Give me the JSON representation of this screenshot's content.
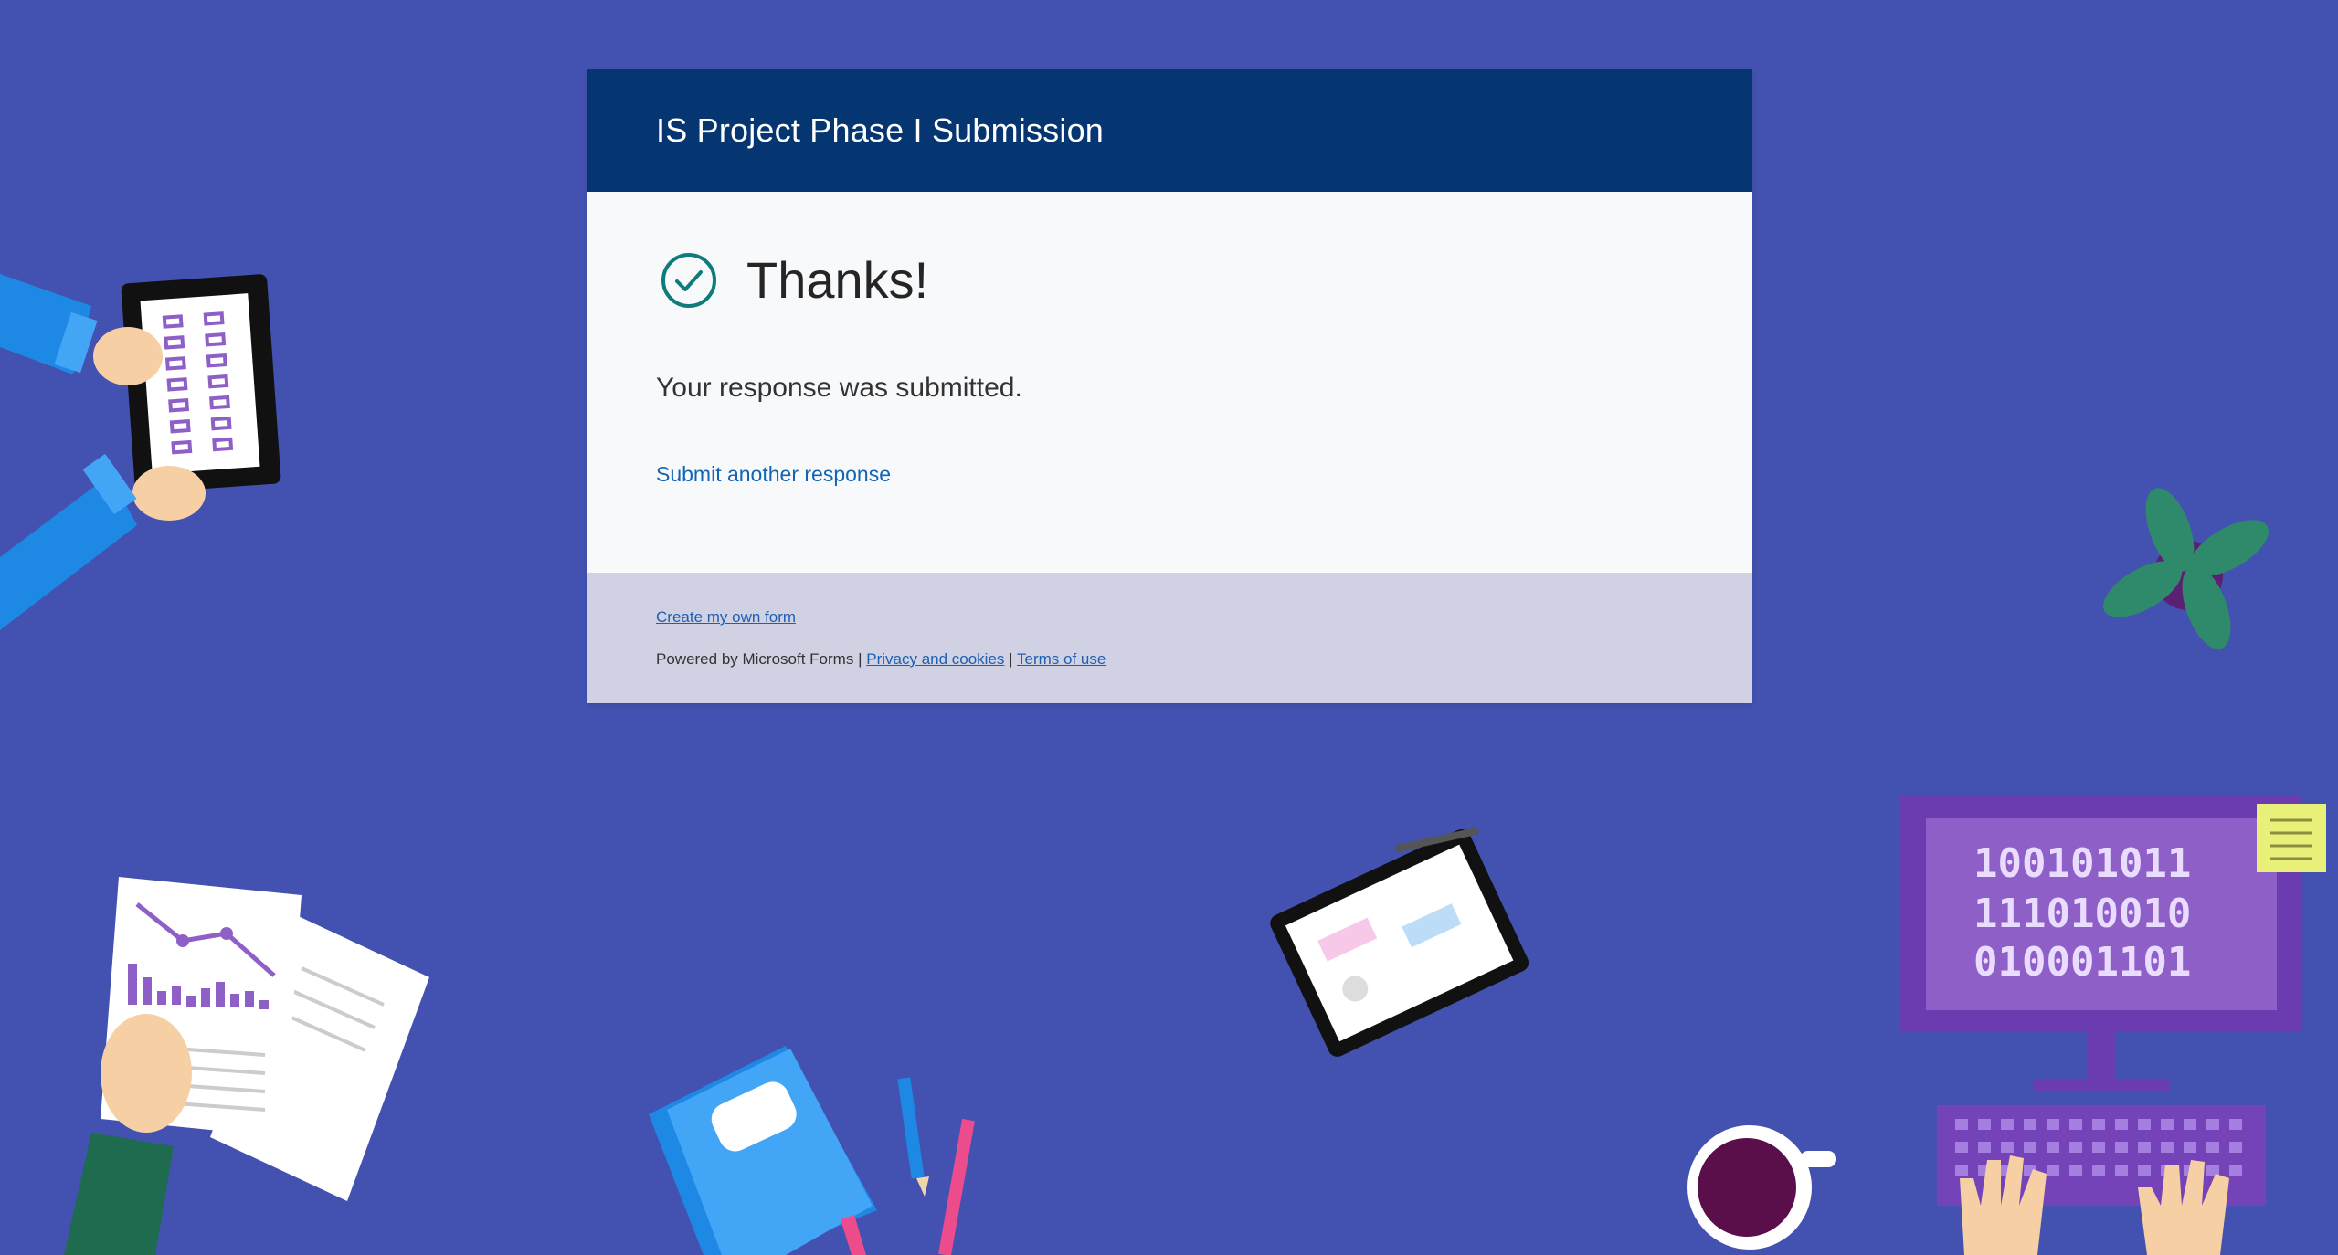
{
  "form": {
    "title": "IS Project Phase I Submission"
  },
  "confirmation": {
    "heading": "Thanks!",
    "message": "Your response was submitted.",
    "submit_another_label": "Submit another response"
  },
  "footer": {
    "create_form_label": "Create my own form",
    "powered_by": "Powered by Microsoft Forms",
    "separator": "|",
    "privacy_label": "Privacy and cookies",
    "terms_label": "Terms of use"
  },
  "decoration": {
    "binary_lines": [
      "100101011",
      "111010010",
      "010001101"
    ]
  },
  "colors": {
    "background": "#4352b0",
    "header": "#063672",
    "check": "#0f7b7b",
    "link": "#1264b5",
    "footer": "#d0d2e4"
  }
}
